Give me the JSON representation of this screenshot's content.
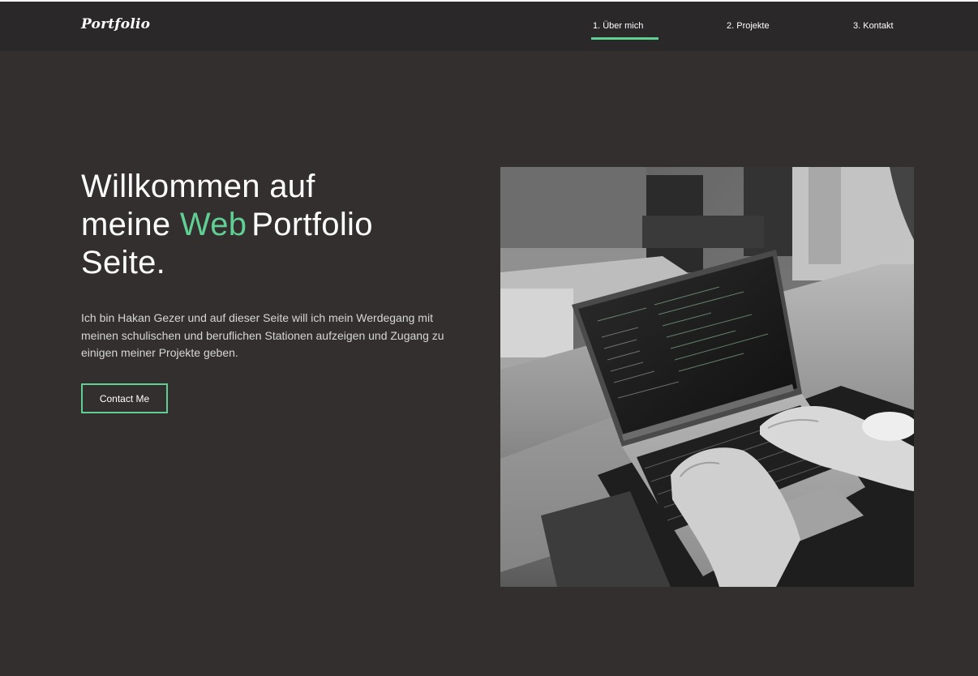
{
  "header": {
    "logo": "Portfolio",
    "nav": [
      {
        "label": "1. Über mich",
        "active": true
      },
      {
        "label": "2. Projekte",
        "active": false
      },
      {
        "label": "3. Kontakt",
        "active": false
      }
    ]
  },
  "hero": {
    "title_line1": "Willkommen auf",
    "title_line2_prefix": "meine ",
    "title_accent": "Web",
    "title_line2_suffix": "Portfolio",
    "title_line3": "Seite.",
    "intro": "Ich bin Hakan Gezer und auf dieser Seite will ich mein Werdegang mit meinen schulischen und beruflichen Stationen aufzeigen und Zugang zu einigen meiner Projekte geben.",
    "cta_label": "Contact Me",
    "image_subject": "laptop-typing-photo"
  },
  "colors": {
    "background": "#332f2e",
    "navbar": "#2a2828",
    "accent": "#5fcf93",
    "text": "#ffffff"
  }
}
